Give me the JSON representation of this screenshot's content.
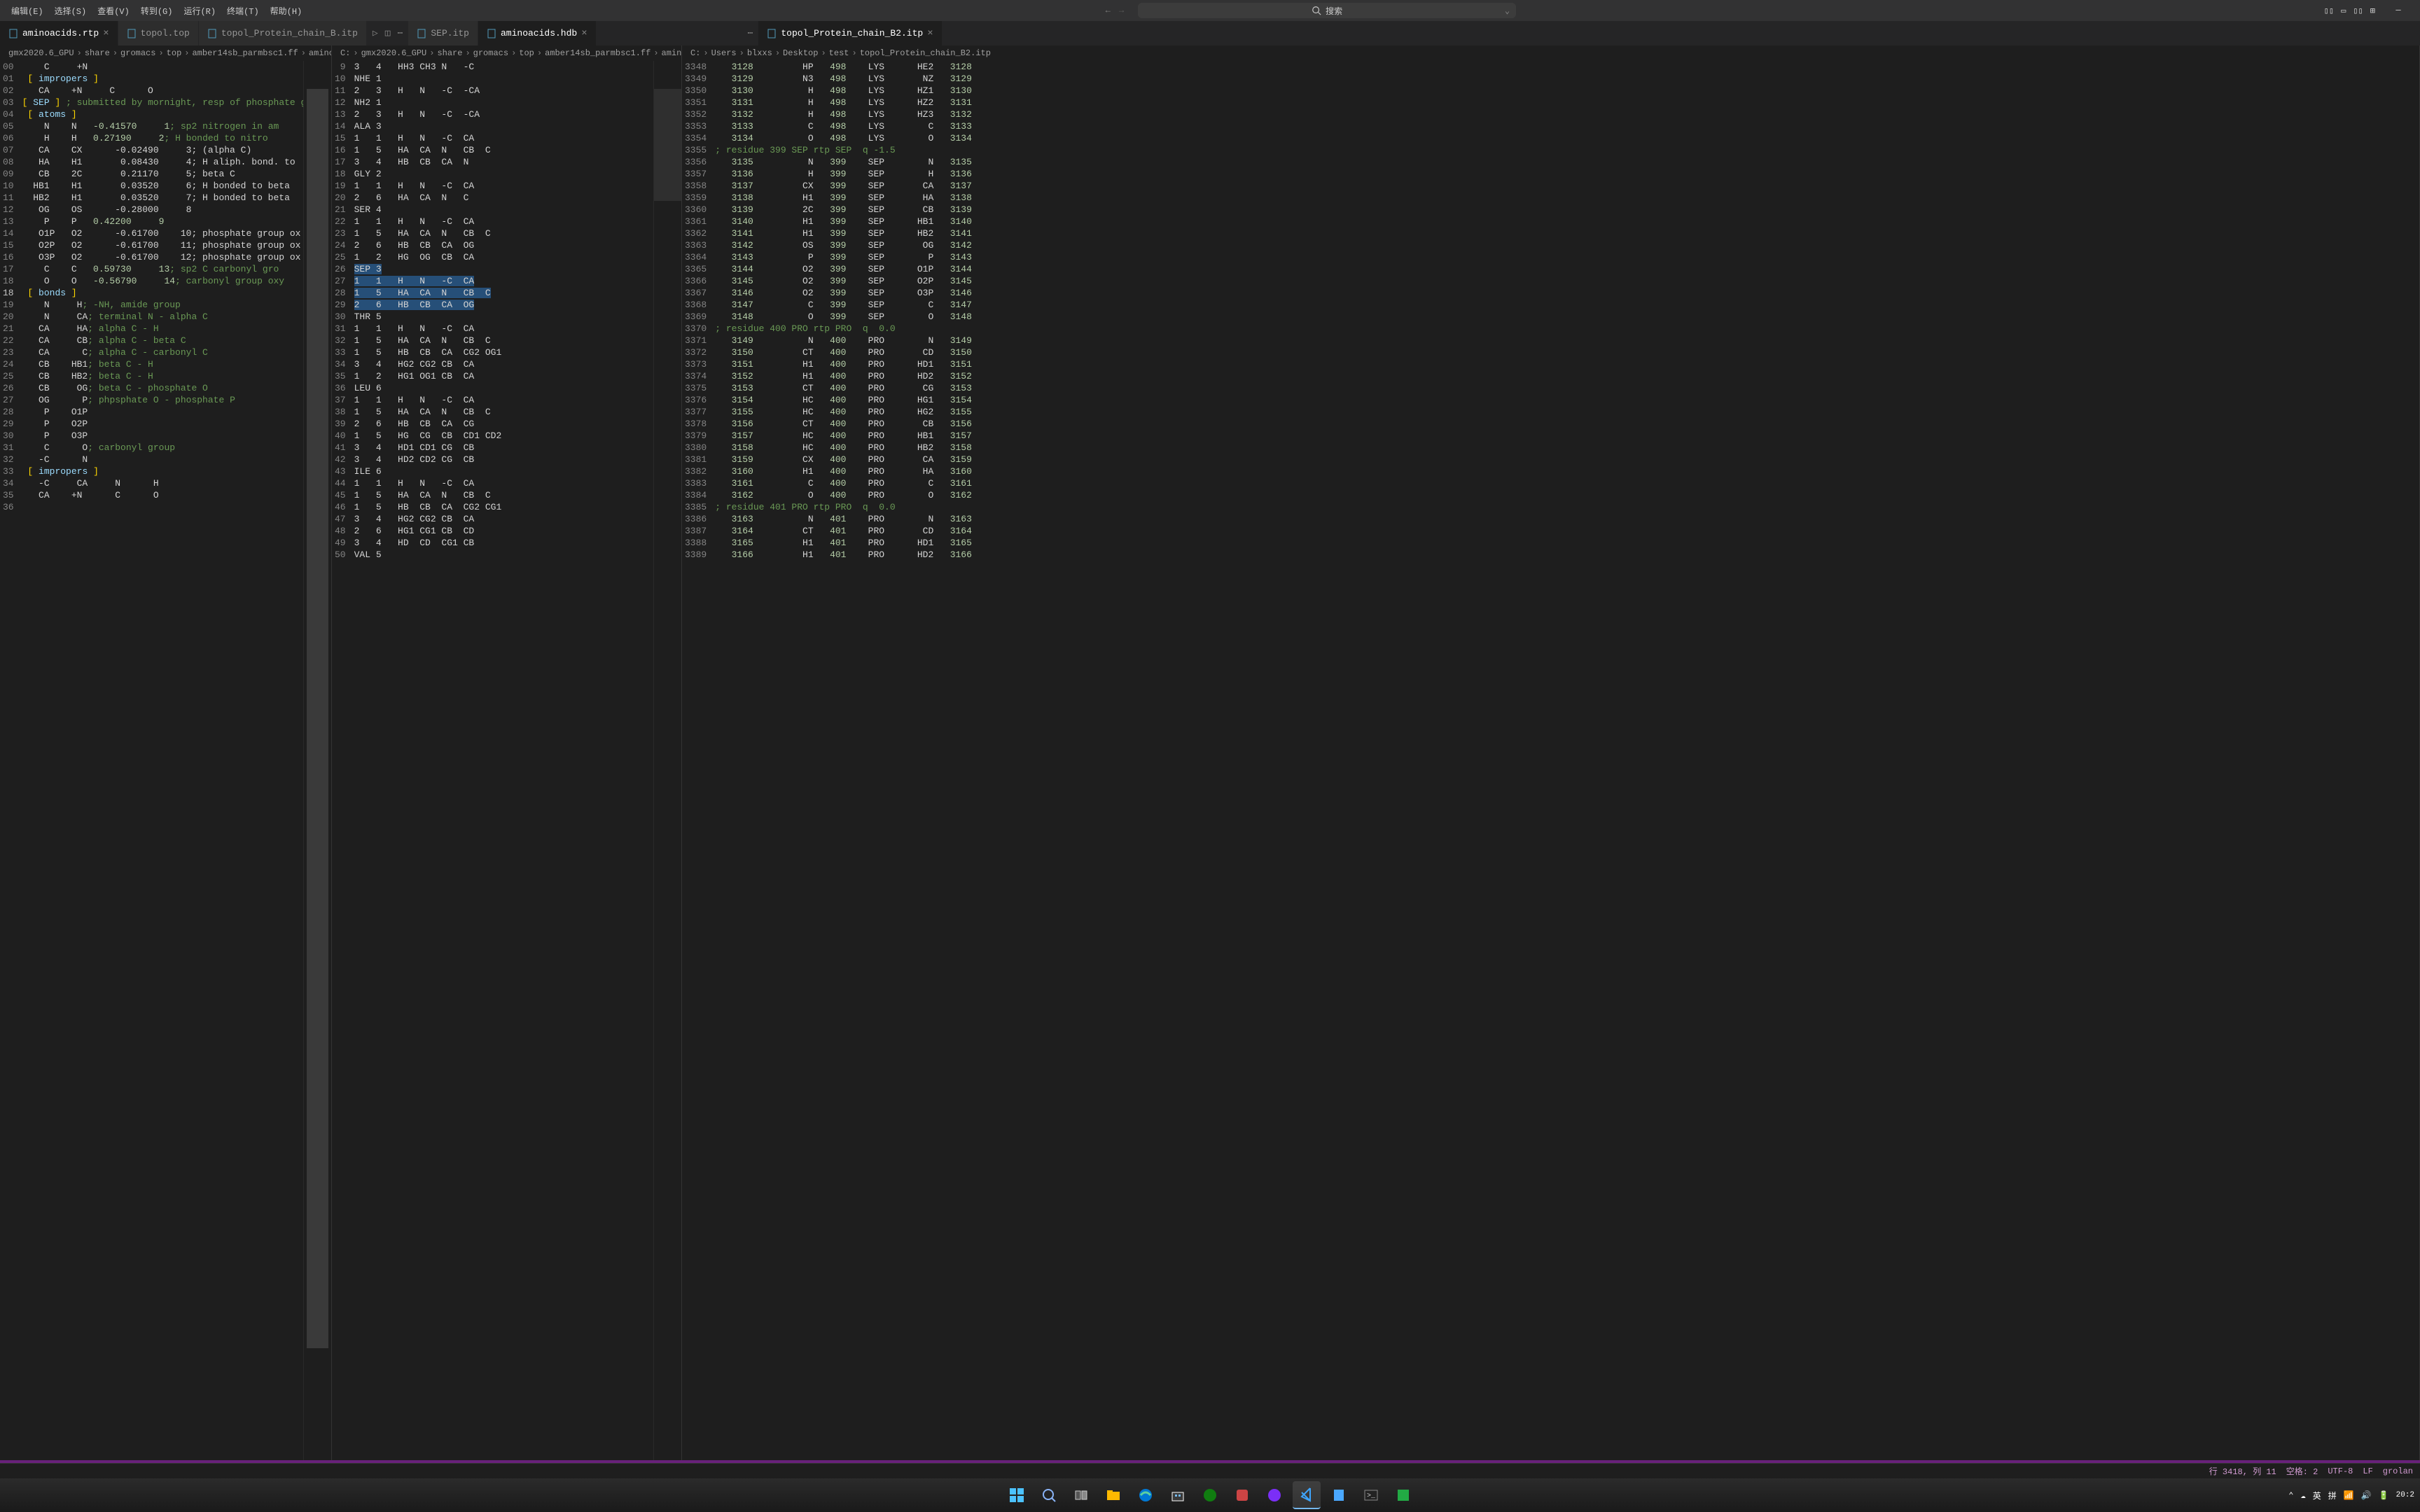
{
  "menu": [
    "编辑(E)",
    "选择(S)",
    "查看(V)",
    "转到(G)",
    "运行(R)",
    "终端(T)",
    "帮助(H)"
  ],
  "search_placeholder": "搜索",
  "tabs": {
    "g1": [
      {
        "label": "aminoacids.rtp",
        "active": true
      },
      {
        "label": "topol.top",
        "active": false
      },
      {
        "label": "topol_Protein_chain_B.itp",
        "active": false
      }
    ],
    "g2": [
      {
        "label": "SEP.itp",
        "active": false
      },
      {
        "label": "aminoacids.hdb",
        "active": true
      }
    ],
    "g3": [
      {
        "label": "topol_Protein_chain_B2.itp",
        "active": true
      }
    ]
  },
  "breadcrumbs": {
    "p1": [
      "gmx2020.6_GPU",
      "share",
      "gromacs",
      "top",
      "amber14sb_parmbsc1.ff",
      "aminoacids.rtp"
    ],
    "p2": [
      "C:",
      "gmx2020.6_GPU",
      "share",
      "gromacs",
      "top",
      "amber14sb_parmbsc1.ff",
      "aminoacids.hdb"
    ],
    "p3": [
      "C:",
      "Users",
      "blxxs",
      "Desktop",
      "test",
      "topol_Protein_chain_B2.itp"
    ]
  },
  "pane1": {
    "start": 0,
    "hl": 18,
    "lines": [
      {
        "n": "00",
        "t": "    C     +N"
      },
      {
        "n": "01",
        "t": "[ impropers ]",
        "kind": "section"
      },
      {
        "n": "02",
        "t": "   CA    +N     C      O"
      },
      {
        "n": "",
        "t": ""
      },
      {
        "n": "03",
        "t": "[ SEP ] ; submitted by mornight, resp of phosphate grou",
        "kind": "sep"
      },
      {
        "n": "04",
        "t": "[ atoms ]",
        "kind": "section"
      },
      {
        "n": "05",
        "t": "    N    N       -0.41570     1; sp2 nitrogen in am",
        "kind": "atom"
      },
      {
        "n": "06",
        "t": "    H    H        0.27190     2; H bonded to nitro",
        "kind": "atom"
      },
      {
        "n": "07",
        "t": "   CA    CX      -0.02490     3; (alpha C)",
        "kind": "atom"
      },
      {
        "n": "08",
        "t": "   HA    H1       0.08430     4; H aliph. bond. to",
        "kind": "atom"
      },
      {
        "n": "09",
        "t": "   CB    2C       0.21170     5; beta C",
        "kind": "atom"
      },
      {
        "n": "10",
        "t": "  HB1    H1       0.03520     6; H bonded to beta ",
        "kind": "atom"
      },
      {
        "n": "11",
        "t": "  HB2    H1       0.03520     7; H bonded to beta ",
        "kind": "atom"
      },
      {
        "n": "12",
        "t": "   OG    OS      -0.28000     8",
        "kind": "atom"
      },
      {
        "n": "13",
        "t": "    P    P        0.42200     9",
        "kind": "atom"
      },
      {
        "n": "14",
        "t": "   O1P   O2      -0.61700    10; phosphate group ox",
        "kind": "atom"
      },
      {
        "n": "15",
        "t": "   O2P   O2      -0.61700    11; phosphate group ox",
        "kind": "atom"
      },
      {
        "n": "16",
        "t": "   O3P   O2      -0.61700    12; phosphate group ox",
        "kind": "atom"
      },
      {
        "n": "17",
        "t": "    C    C        0.59730    13; sp2 C carbonyl gro",
        "kind": "atom"
      },
      {
        "n": "18",
        "t": "    O    O       -0.56790    14; carbonyl group oxy",
        "kind": "atom"
      },
      {
        "n": "18",
        "t": " [ bonds ]",
        "kind": "section",
        "hl": true
      },
      {
        "n": "19",
        "t": "    N     H; -NH, amide group",
        "kind": "bond"
      },
      {
        "n": "20",
        "t": "    N     CA; terminal N - alpha C",
        "kind": "bond"
      },
      {
        "n": "21",
        "t": "   CA     HA; alpha C - H",
        "kind": "bond"
      },
      {
        "n": "22",
        "t": "   CA     CB; alpha C - beta C",
        "kind": "bond"
      },
      {
        "n": "23",
        "t": "   CA      C; alpha C - carbonyl C",
        "kind": "bond"
      },
      {
        "n": "24",
        "t": "   CB    HB1; beta C - H",
        "kind": "bond"
      },
      {
        "n": "25",
        "t": "   CB    HB2; beta C - H",
        "kind": "bond"
      },
      {
        "n": "26",
        "t": "   CB     OG; beta C - phosphate O",
        "kind": "bond"
      },
      {
        "n": "27",
        "t": "   OG      P; phpsphate O - phosphate P",
        "kind": "bond"
      },
      {
        "n": "28",
        "t": "    P    O1P"
      },
      {
        "n": "29",
        "t": "    P    O2P"
      },
      {
        "n": "30",
        "t": "    P    O3P"
      },
      {
        "n": "31",
        "t": "    C      O; carbonyl group",
        "kind": "bond"
      },
      {
        "n": "32",
        "t": "   -C      N"
      },
      {
        "n": "33",
        "t": " [ impropers ]",
        "kind": "section"
      },
      {
        "n": "34",
        "t": "   -C     CA     N      H"
      },
      {
        "n": "35",
        "t": "   CA    +N      C      O"
      },
      {
        "n": "36",
        "t": ""
      }
    ]
  },
  "pane2": {
    "lines": [
      {
        "n": 9,
        "t": "3   4   HH3 CH3 N   -C"
      },
      {
        "n": 10,
        "t": "NHE 1"
      },
      {
        "n": 11,
        "t": "2   3   H   N   -C  -CA"
      },
      {
        "n": 12,
        "t": "NH2 1"
      },
      {
        "n": 13,
        "t": "2   3   H   N   -C  -CA"
      },
      {
        "n": 14,
        "t": "ALA 3"
      },
      {
        "n": 15,
        "t": "1   1   H   N   -C  CA"
      },
      {
        "n": 16,
        "t": "1   5   HA  CA  N   CB  C"
      },
      {
        "n": 17,
        "t": "3   4   HB  CB  CA  N"
      },
      {
        "n": 18,
        "t": "GLY 2"
      },
      {
        "n": 19,
        "t": "1   1   H   N   -C  CA"
      },
      {
        "n": 20,
        "t": "2   6   HA  CA  N   C"
      },
      {
        "n": 21,
        "t": "SER 4"
      },
      {
        "n": 22,
        "t": "1   1   H   N   -C  CA"
      },
      {
        "n": 23,
        "t": "1   5   HA  CA  N   CB  C"
      },
      {
        "n": 24,
        "t": "2   6   HB  CB  CA  OG"
      },
      {
        "n": 25,
        "t": "1   2   HG  OG  CB  CA"
      },
      {
        "n": 26,
        "t": "SEP 3",
        "sel": true
      },
      {
        "n": 27,
        "t": "1   1   H   N   -C  CA",
        "sel": true
      },
      {
        "n": 28,
        "t": "1   5   HA  CA  N   CB  C",
        "sel": true
      },
      {
        "n": 29,
        "t": "2   6   HB  CB  CA  OG",
        "sel": true
      },
      {
        "n": 30,
        "t": "THR 5"
      },
      {
        "n": 31,
        "t": "1   1   H   N   -C  CA"
      },
      {
        "n": 32,
        "t": "1   5   HA  CA  N   CB  C"
      },
      {
        "n": 33,
        "t": "1   5   HB  CB  CA  CG2 OG1"
      },
      {
        "n": 34,
        "t": "3   4   HG2 CG2 CB  CA"
      },
      {
        "n": 35,
        "t": "1   2   HG1 OG1 CB  CA"
      },
      {
        "n": 36,
        "t": "LEU 6"
      },
      {
        "n": 37,
        "t": "1   1   H   N   -C  CA"
      },
      {
        "n": 38,
        "t": "1   5   HA  CA  N   CB  C"
      },
      {
        "n": 39,
        "t": "2   6   HB  CB  CA  CG"
      },
      {
        "n": 40,
        "t": "1   5   HG  CG  CB  CD1 CD2"
      },
      {
        "n": 41,
        "t": "3   4   HD1 CD1 CG  CB"
      },
      {
        "n": 42,
        "t": "3   4   HD2 CD2 CG  CB"
      },
      {
        "n": 43,
        "t": "ILE 6"
      },
      {
        "n": 44,
        "t": "1   1   H   N   -C  CA"
      },
      {
        "n": 45,
        "t": "1   5   HA  CA  N   CB  C"
      },
      {
        "n": 46,
        "t": "1   5   HB  CB  CA  CG2 CG1"
      },
      {
        "n": 47,
        "t": "3   4   HG2 CG2 CB  CA"
      },
      {
        "n": 48,
        "t": "2   6   HG1 CG1 CB  CD"
      },
      {
        "n": 49,
        "t": "3   4   HD  CD  CG1 CB"
      },
      {
        "n": 50,
        "t": "VAL 5"
      }
    ]
  },
  "pane3": {
    "lines": [
      {
        "n": 3348,
        "a": 3128,
        "b": "HP",
        "c": 498,
        "d": "LYS",
        "e": "HE2",
        "f": 3128
      },
      {
        "n": 3349,
        "a": 3129,
        "b": "N3",
        "c": 498,
        "d": "LYS",
        "e": "NZ",
        "f": 3129
      },
      {
        "n": 3350,
        "a": 3130,
        "b": "H",
        "c": 498,
        "d": "LYS",
        "e": "HZ1",
        "f": 3130
      },
      {
        "n": 3351,
        "a": 3131,
        "b": "H",
        "c": 498,
        "d": "LYS",
        "e": "HZ2",
        "f": 3131
      },
      {
        "n": 3352,
        "a": 3132,
        "b": "H",
        "c": 498,
        "d": "LYS",
        "e": "HZ3",
        "f": 3132
      },
      {
        "n": 3353,
        "a": 3133,
        "b": "C",
        "c": 498,
        "d": "LYS",
        "e": "C",
        "f": 3133
      },
      {
        "n": 3354,
        "a": 3134,
        "b": "O",
        "c": 498,
        "d": "LYS",
        "e": "O",
        "f": 3134
      },
      {
        "n": 3355,
        "comment": "; residue 399 SEP rtp SEP  q -1.5"
      },
      {
        "n": 3356,
        "a": 3135,
        "b": "N",
        "c": 399,
        "d": "SEP",
        "e": "N",
        "f": 3135
      },
      {
        "n": 3357,
        "a": 3136,
        "b": "H",
        "c": 399,
        "d": "SEP",
        "e": "H",
        "f": 3136
      },
      {
        "n": 3358,
        "a": 3137,
        "b": "CX",
        "c": 399,
        "d": "SEP",
        "e": "CA",
        "f": 3137
      },
      {
        "n": 3359,
        "a": 3138,
        "b": "H1",
        "c": 399,
        "d": "SEP",
        "e": "HA",
        "f": 3138
      },
      {
        "n": 3360,
        "a": 3139,
        "b": "2C",
        "c": 399,
        "d": "SEP",
        "e": "CB",
        "f": 3139
      },
      {
        "n": 3361,
        "a": 3140,
        "b": "H1",
        "c": 399,
        "d": "SEP",
        "e": "HB1",
        "f": 3140
      },
      {
        "n": 3362,
        "a": 3141,
        "b": "H1",
        "c": 399,
        "d": "SEP",
        "e": "HB2",
        "f": 3141
      },
      {
        "n": 3363,
        "a": 3142,
        "b": "OS",
        "c": 399,
        "d": "SEP",
        "e": "OG",
        "f": 3142
      },
      {
        "n": 3364,
        "a": 3143,
        "b": "P",
        "c": 399,
        "d": "SEP",
        "e": "P",
        "f": 3143
      },
      {
        "n": 3365,
        "a": 3144,
        "b": "O2",
        "c": 399,
        "d": "SEP",
        "e": "O1P",
        "f": 3144
      },
      {
        "n": 3366,
        "a": 3145,
        "b": "O2",
        "c": 399,
        "d": "SEP",
        "e": "O2P",
        "f": 3145
      },
      {
        "n": 3367,
        "a": 3146,
        "b": "O2",
        "c": 399,
        "d": "SEP",
        "e": "O3P",
        "f": 3146
      },
      {
        "n": 3368,
        "a": 3147,
        "b": "C",
        "c": 399,
        "d": "SEP",
        "e": "C",
        "f": 3147
      },
      {
        "n": 3369,
        "a": 3148,
        "b": "O",
        "c": 399,
        "d": "SEP",
        "e": "O",
        "f": 3148
      },
      {
        "n": 3370,
        "comment": "; residue 400 PRO rtp PRO  q  0.0"
      },
      {
        "n": 3371,
        "a": 3149,
        "b": "N",
        "c": 400,
        "d": "PRO",
        "e": "N",
        "f": 3149
      },
      {
        "n": 3372,
        "a": 3150,
        "b": "CT",
        "c": 400,
        "d": "PRO",
        "e": "CD",
        "f": 3150
      },
      {
        "n": 3373,
        "a": 3151,
        "b": "H1",
        "c": 400,
        "d": "PRO",
        "e": "HD1",
        "f": 3151
      },
      {
        "n": 3374,
        "a": 3152,
        "b": "H1",
        "c": 400,
        "d": "PRO",
        "e": "HD2",
        "f": 3152
      },
      {
        "n": 3375,
        "a": 3153,
        "b": "CT",
        "c": 400,
        "d": "PRO",
        "e": "CG",
        "f": 3153
      },
      {
        "n": 3376,
        "a": 3154,
        "b": "HC",
        "c": 400,
        "d": "PRO",
        "e": "HG1",
        "f": 3154
      },
      {
        "n": 3377,
        "a": 3155,
        "b": "HC",
        "c": 400,
        "d": "PRO",
        "e": "HG2",
        "f": 3155
      },
      {
        "n": 3378,
        "a": 3156,
        "b": "CT",
        "c": 400,
        "d": "PRO",
        "e": "CB",
        "f": 3156
      },
      {
        "n": 3379,
        "a": 3157,
        "b": "HC",
        "c": 400,
        "d": "PRO",
        "e": "HB1",
        "f": 3157
      },
      {
        "n": 3380,
        "a": 3158,
        "b": "HC",
        "c": 400,
        "d": "PRO",
        "e": "HB2",
        "f": 3158
      },
      {
        "n": 3381,
        "a": 3159,
        "b": "CX",
        "c": 400,
        "d": "PRO",
        "e": "CA",
        "f": 3159
      },
      {
        "n": 3382,
        "a": 3160,
        "b": "H1",
        "c": 400,
        "d": "PRO",
        "e": "HA",
        "f": 3160
      },
      {
        "n": 3383,
        "a": 3161,
        "b": "C",
        "c": 400,
        "d": "PRO",
        "e": "C",
        "f": 3161
      },
      {
        "n": 3384,
        "a": 3162,
        "b": "O",
        "c": 400,
        "d": "PRO",
        "e": "O",
        "f": 3162
      },
      {
        "n": 3385,
        "comment": "; residue 401 PRO rtp PRO  q  0.0"
      },
      {
        "n": 3386,
        "a": 3163,
        "b": "N",
        "c": 401,
        "d": "PRO",
        "e": "N",
        "f": 3163
      },
      {
        "n": 3387,
        "a": 3164,
        "b": "CT",
        "c": 401,
        "d": "PRO",
        "e": "CD",
        "f": 3164
      },
      {
        "n": 3388,
        "a": 3165,
        "b": "H1",
        "c": 401,
        "d": "PRO",
        "e": "HD1",
        "f": 3165
      },
      {
        "n": 3389,
        "a": 3166,
        "b": "H1",
        "c": 401,
        "d": "PRO",
        "e": "HD2",
        "f": 3166
      }
    ]
  },
  "status": {
    "pos": "行 3418, 列 11",
    "spaces": "空格: 2",
    "enc": "UTF-8",
    "eol": "LF",
    "lang": "grolan"
  },
  "tray": {
    "ime1": "英",
    "ime2": "拼",
    "time": "20:2"
  }
}
